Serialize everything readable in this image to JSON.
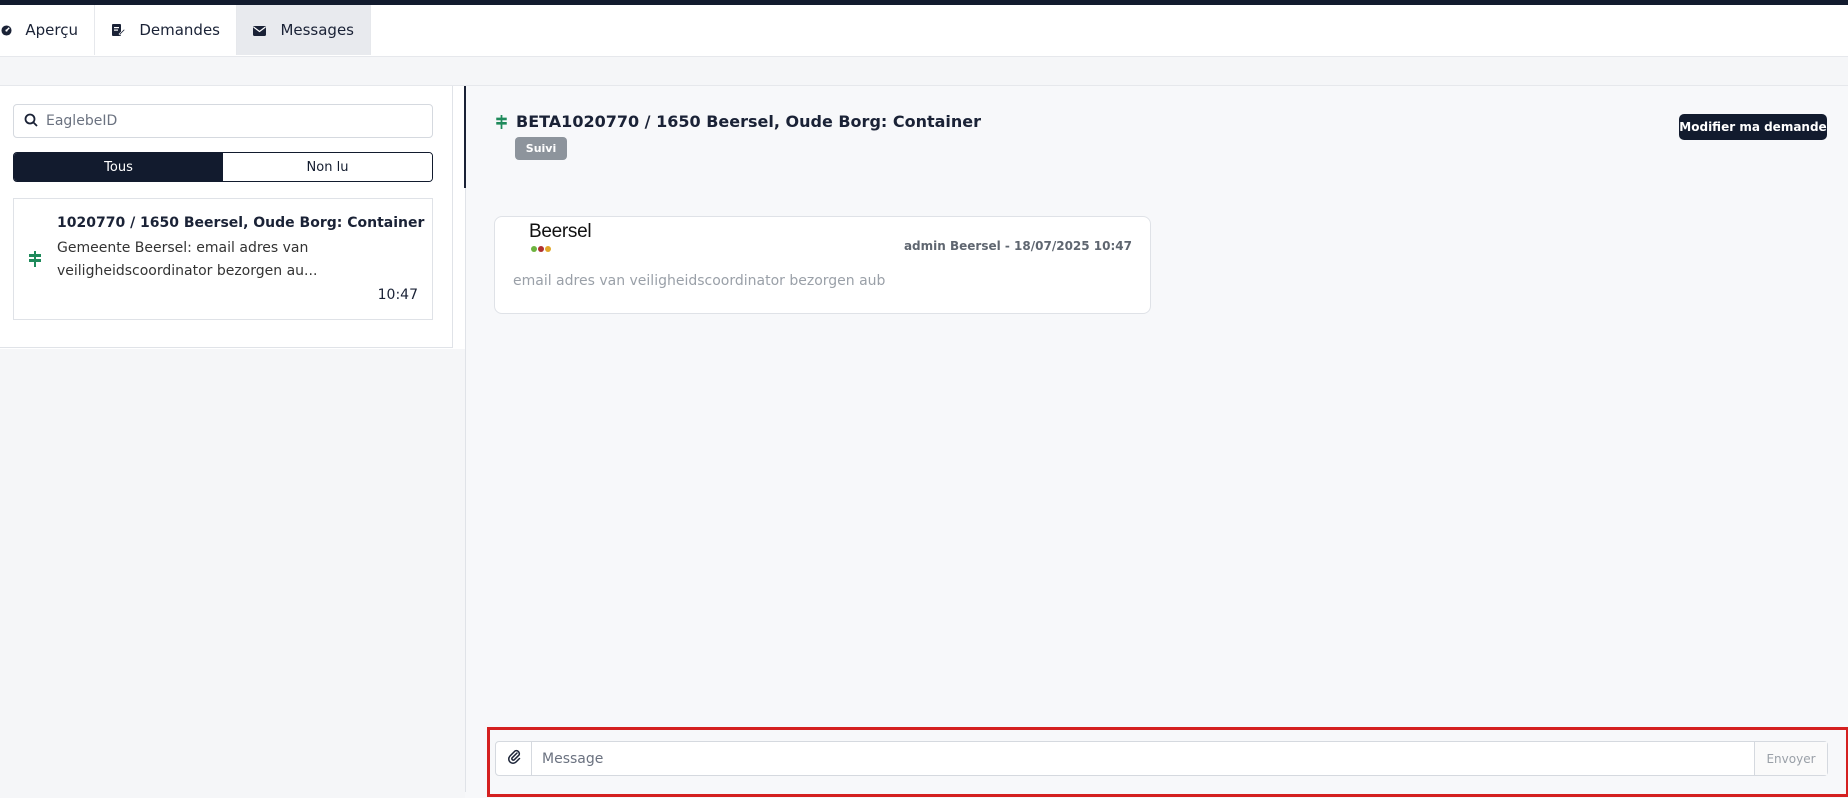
{
  "tabs": [
    {
      "label": "Aperçu",
      "icon": "dashboard-icon"
    },
    {
      "label": "Demandes",
      "icon": "edit-document-icon"
    },
    {
      "label": "Messages",
      "icon": "envelope-icon",
      "active": true
    }
  ],
  "sidebar": {
    "search_placeholder": "EaglebeID",
    "filters": {
      "all": "Tous",
      "unread": "Non lu"
    },
    "conversation": {
      "title": "1020770 / 1650 Beersel, Oude Borg: Container",
      "preview": "Gemeente Beersel: email adres van veiligheidscoordinator bezorgen au...",
      "time": "10:47",
      "icon": "signpost-icon"
    }
  },
  "thread": {
    "title": "BETA1020770 / 1650 Beersel, Oude Borg: Container",
    "status": "Suivi",
    "modify_button": "Modifier ma demande",
    "message": {
      "sender_logo": "Beersel",
      "meta": "admin Beersel - 18/07/2025 10:47",
      "text": "email adres van veiligheidscoordinator bezorgen aub"
    }
  },
  "composer": {
    "placeholder": "Message",
    "send_label": "Envoyer"
  },
  "colors": {
    "primary": "#121b2e",
    "accent_green": "#1f8a5b",
    "badge_grey": "#8d949c",
    "highlight_red": "#d42020"
  }
}
